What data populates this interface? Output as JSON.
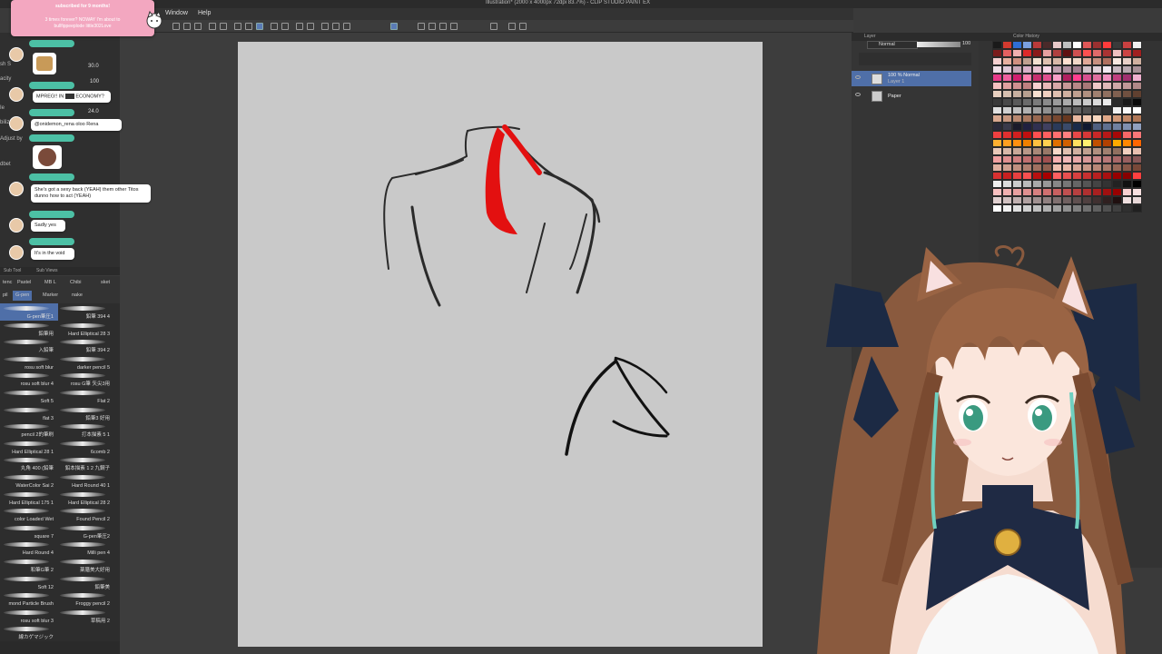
{
  "app": {
    "title": "Illustration* (2000 x 4000px 72dpi 83.7%) - CLIP STUDIO PAINT EX",
    "menu": [
      "Window",
      "Help"
    ]
  },
  "notice": {
    "line1": "subscribed for 9 months!",
    "line2": "3 times forever? NOWAY I'm about to",
    "line3": "bullfippeeplode little302Love"
  },
  "tool_props": {
    "labels": [
      "sh S",
      "acity",
      "Ie",
      "bilize",
      "Adjust by",
      "dbet"
    ],
    "values": [
      "30.0",
      "100",
      "24.0"
    ]
  },
  "chat": [
    {
      "text": "MPREG!! IN",
      "text2": "ECONOMY?"
    },
    {
      "text": "@onidemon_rena oloo Rena"
    },
    {
      "text": "She's got a sexy back (YEAH) them other Titos dunno how to act (YEAH)"
    },
    {
      "text": "Sadly yes"
    },
    {
      "text": "It's in the void"
    }
  ],
  "subtool": {
    "header": [
      "Sub Tool",
      "Sub Views"
    ],
    "tabs_row1": [
      "tenc",
      "Pastel",
      "MB L",
      "Chibi",
      "sket"
    ],
    "tabs_row2": [
      "pil",
      "G-pen",
      "Marker",
      "nake"
    ],
    "brushes_left": [
      "G-pen筆圧1",
      "鉛筆用",
      "入鉛筆",
      "rosu soft blur",
      "rosu soft blur 4",
      "Soft 5",
      "flat 3",
      "pencil 2的筆刷",
      "Hard Elliptical 28 1",
      "丸角 400 (鉛筆",
      "WaterColor Sai 2",
      "Hard Elliptical 175 1",
      "color Loaded Wet",
      "square 7",
      "Hard Round 4",
      "和筆G筆 2",
      "Soft 12",
      "mond Particle Brush",
      "rosu soft blur 3",
      "線カゲマジック"
    ],
    "brushes_right": [
      "鉛筆 394 4",
      "Hard Elliptical 28 3",
      "鉛筆 394 2",
      "darker pencil 5",
      "rosu G筆 矢尖3用",
      "Flat 2",
      "鉛筆3 好用",
      "打本描素 5 1",
      "6comb 2",
      "鉛本描素 1 2 九鋼子",
      "Hard Round 40 1",
      "Hard Elliptical 28 2",
      "Found Pencil 2",
      "G-pen筆圧2",
      "Milli pen 4",
      "薬膳美大好用",
      "鉛筆美",
      "Froggy pencil 2",
      "草稿用 2"
    ]
  },
  "layers": {
    "panel_title": "Layer",
    "blend_mode": "Normal",
    "opacity": "100",
    "rows": [
      {
        "line1": "100 % Normal",
        "line2": "Layer 1"
      },
      {
        "line1": "Paper",
        "line2": ""
      }
    ]
  },
  "color_history": {
    "title": "Color History",
    "colors": [
      "#1a1a1a",
      "#d23a2f",
      "#2f6fd6",
      "#7aa0e0",
      "#b83a3a",
      "#4a2a2a",
      "#e8c8c8",
      "#c0c0c0",
      "#ffffff",
      "#e05858",
      "#9a3030",
      "#ff3b3b",
      "#3a3a3a",
      "#c84040",
      "#f0f0f0",
      "#7a1c1c",
      "#e46060",
      "#f2b0b0",
      "#dd2a2a",
      "#8a1a1a",
      "#e8a0a0",
      "#b04040",
      "#601010",
      "#d05050",
      "#ff5050",
      "#e06a6a",
      "#aa3333",
      "#f0c0c0",
      "#cc4444",
      "#a02020",
      "#f5d0d0",
      "#e8b0a0",
      "#d09080",
      "#c0a090",
      "#f2e0d0",
      "#e0c0b0",
      "#d8b8a8",
      "#ffe0d0",
      "#f0d8c8",
      "#e0a898",
      "#c89080",
      "#b07060",
      "#f8e8e0",
      "#e8d0c8",
      "#d0b0a0",
      "#f0e0e8",
      "#e0c8d8",
      "#c8a8b8",
      "#d8b0c8",
      "#e8c0d0",
      "#f8d8e8",
      "#c0a0b0",
      "#b090a0",
      "#a08090",
      "#d0c0c8",
      "#e0d0d8",
      "#f0e8f0",
      "#c8b8c0",
      "#b8a8b0",
      "#a89098",
      "#e83a8a",
      "#f060a0",
      "#d02070",
      "#ff80b0",
      "#c83070",
      "#e05090",
      "#f8a0c8",
      "#b02060",
      "#ff4090",
      "#d85090",
      "#e070a0",
      "#f090c0",
      "#c04080",
      "#a03070",
      "#f0b0d0",
      "#f5c0c0",
      "#e0a0a0",
      "#d09090",
      "#c08080",
      "#f8d0d0",
      "#e8b8b8",
      "#d8a8a8",
      "#c89898",
      "#b88888",
      "#a87878",
      "#f0c8c8",
      "#e0b8b8",
      "#d0a8a8",
      "#c09898",
      "#b08888",
      "#e8d0c0",
      "#d8c0b0",
      "#c8b0a0",
      "#b8a090",
      "#f8e0d0",
      "#f0d0c0",
      "#e0c0b0",
      "#d0b0a0",
      "#c0a090",
      "#b09080",
      "#a08070",
      "#907060",
      "#806050",
      "#705040",
      "#604030",
      "#3a3a3a",
      "#4a4a4a",
      "#5a5a5a",
      "#6a6a6a",
      "#7a7a7a",
      "#8a8a8a",
      "#9a9a9a",
      "#aaaaaa",
      "#bababa",
      "#cacaca",
      "#dadada",
      "#eaeaea",
      "#2a2a2a",
      "#1a1a1a",
      "#0a0a0a",
      "#e0e0e0",
      "#d0d0d0",
      "#c0c0c0",
      "#b0b0b0",
      "#a0a0a0",
      "#909090",
      "#808080",
      "#707070",
      "#606060",
      "#505050",
      "#404040",
      "#303030",
      "#f0f0f0",
      "#f8f8f8",
      "#ffffff",
      "#d8a890",
      "#c89880",
      "#b88870",
      "#a87860",
      "#986850",
      "#885840",
      "#784830",
      "#683820",
      "#e8b8a0",
      "#f0c8b0",
      "#f8d8c0",
      "#e0a888",
      "#d09878",
      "#c08868",
      "#b07858",
      "#2a2a3a",
      "#3a3a4a",
      "#1a1a2a",
      "#202040",
      "#303050",
      "#404060",
      "#2a3a5a",
      "#3a4a6a",
      "#1a2a4a",
      "#101830",
      "#506080",
      "#607090",
      "#7080a0",
      "#8090b0",
      "#90a0c0",
      "#f04040",
      "#e03030",
      "#d02020",
      "#c01010",
      "#ff5050",
      "#ff6060",
      "#ff7070",
      "#ff8080",
      "#e84848",
      "#d83838",
      "#c82828",
      "#b81818",
      "#a80808",
      "#f86868",
      "#f87878",
      "#ffb030",
      "#ffa020",
      "#ff9010",
      "#f08000",
      "#ffc040",
      "#ffd050",
      "#e07000",
      "#d06000",
      "#ffe060",
      "#fff070",
      "#c05000",
      "#b04000",
      "#ffaa00",
      "#ff8800",
      "#ff6600",
      "#e8c8b8",
      "#d8b8a8",
      "#c8a898",
      "#b89888",
      "#a88878",
      "#987868",
      "#f8d8c8",
      "#e0c0b0",
      "#d0b0a0",
      "#c0a090",
      "#b09080",
      "#a08070",
      "#907060",
      "#f0d0c0",
      "#e8c0b0",
      "#f0a0a0",
      "#e09090",
      "#d08080",
      "#c07070",
      "#b06060",
      "#a05050",
      "#f8b0b0",
      "#f0b8b8",
      "#e8a8a8",
      "#d89898",
      "#c88888",
      "#b87878",
      "#a86868",
      "#986060",
      "#885858",
      "#e0b0a0",
      "#d0a090",
      "#c09080",
      "#b08070",
      "#a07060",
      "#906050",
      "#f0c0b0",
      "#e8b8a8",
      "#d8a898",
      "#c89888",
      "#b88878",
      "#a87868",
      "#986858",
      "#885848",
      "#784838",
      "#d83030",
      "#c82020",
      "#e84040",
      "#f85050",
      "#b81010",
      "#a80000",
      "#ff6060",
      "#e85050",
      "#d84040",
      "#c83030",
      "#b82020",
      "#a81010",
      "#980000",
      "#880000",
      "#ff4040",
      "#eeeeee",
      "#dddddd",
      "#cccccc",
      "#bbbbbb",
      "#aaaaaa",
      "#999999",
      "#888888",
      "#777777",
      "#666666",
      "#555555",
      "#444444",
      "#333333",
      "#222222",
      "#111111",
      "#000000",
      "#f8c0c0",
      "#f0b0b0",
      "#e8a0a0",
      "#e09090",
      "#d88080",
      "#d07070",
      "#c86060",
      "#c05050",
      "#b84040",
      "#b03030",
      "#a82020",
      "#a01010",
      "#980000",
      "#f8d0d0",
      "#f8e0e0",
      "#e0d0d0",
      "#d0c0c0",
      "#c0b0b0",
      "#b0a0a0",
      "#a09090",
      "#908080",
      "#807070",
      "#706060",
      "#605050",
      "#504040",
      "#403030",
      "#302020",
      "#201010",
      "#f0e0e0",
      "#e8d8d8",
      "#ffffff",
      "#f0f0f0",
      "#e0e0e0",
      "#d0d0d0",
      "#c0c0c0",
      "#b0b0b0",
      "#a0a0a0",
      "#909090",
      "#808080",
      "#707070",
      "#606060",
      "#505050",
      "#404040",
      "#303030",
      "#202020"
    ]
  }
}
